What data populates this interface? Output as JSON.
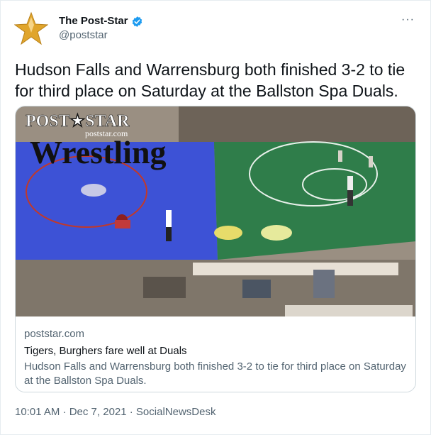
{
  "author": {
    "name": "The Post-Star",
    "handle": "@poststar",
    "verified": true,
    "avatar_icon": "gold-star-icon"
  },
  "more_menu": {
    "label": "···"
  },
  "tweet": {
    "text": "Hudson Falls and Warrensburg both finished 3-2 to tie for third place on Saturday at the Ballston Spa Duals."
  },
  "card": {
    "image": {
      "masthead": "POST★STAR",
      "site": "poststar.com",
      "section": "Wrestling"
    },
    "domain": "poststar.com",
    "title": "Tigers, Burghers fare well at Duals",
    "description": "Hudson Falls and Warrensburg both finished 3-2 to tie for third place on Saturday at the Ballston Spa Duals."
  },
  "footer": {
    "timestamp": "10:01 AM · Dec 7, 2021 · SocialNewsDesk"
  },
  "colors": {
    "verified_blue": "#1d9bf0",
    "mat_blue": "#3d52d6",
    "mat_green": "#2f7d4a",
    "star_gold": "#e0a52c"
  }
}
